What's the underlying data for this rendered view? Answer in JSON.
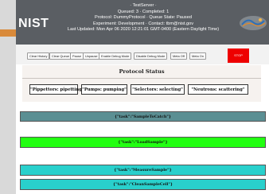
{
  "header": {
    "logo": "NIST",
    "server_title": "· TestServer ·",
    "queue_line": "Queued: 3 · Completed: 1",
    "protocol_line": "Protocol: DummyProtocol · Queue State: Paused",
    "experiment_line": "Experiment: Development · Contact: tbm@nist.gov",
    "updated_line": "Last Updated: Mon Apr 06 2020 12:21:01 GMT-0400 (Eastern Daylight Time)"
  },
  "toolbar": {
    "clear_history": "Clear History",
    "clear_queue": "Clear Queue",
    "pause": "Pause",
    "unpause": "Unpause",
    "enable_debug": "Enable Debug Mode",
    "disable_debug": "Disable Debug Mode",
    "meta_off": "Meta Off",
    "meta_on": "Meta On",
    "stop": "STOP"
  },
  "status": {
    "title": "Protocol Status",
    "items": [
      "\"Pippettors: pipetting\"",
      "\"Pumps: pumping\"",
      "\"Selectors: selecting\"",
      "\"Neutrons: scattering\""
    ]
  },
  "tasks": [
    {
      "label": "{\"task\":\"SampleToCatch\"}",
      "color": "#5b8f93"
    },
    {
      "label": "{\"task\":\"LoadSample\"}",
      "color": "#22ff11"
    },
    {
      "label": "{\"task\":\"MeasureSample\"}",
      "color": "#29d0cc"
    },
    {
      "label": "{\"task\":\"CleanSampleCell\"}",
      "color": "#29d0cc"
    }
  ],
  "colors": {
    "header_bg": "#5a5e63",
    "stop_bg": "#ee0000",
    "history_task": "#5b8f93",
    "active_task": "#22ff11",
    "queued_task": "#29d0cc"
  }
}
